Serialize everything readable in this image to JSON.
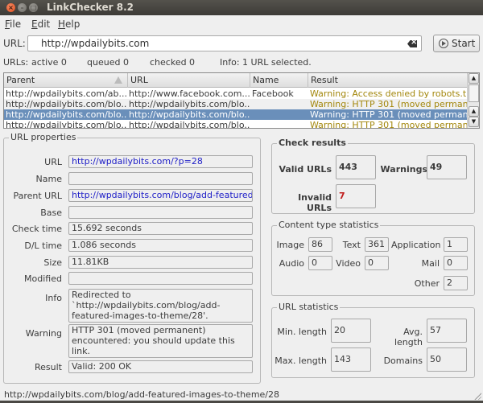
{
  "window": {
    "title": "LinkChecker 8.2"
  },
  "menu": {
    "items": [
      {
        "label": "File"
      },
      {
        "label": "Edit"
      },
      {
        "label": "Help"
      }
    ]
  },
  "url_bar": {
    "label": "URL:",
    "value": "http://wpdailybits.com",
    "start_label": "Start"
  },
  "status": {
    "urls_label": "URLs:",
    "active": "active 0",
    "queued": "queued 0",
    "checked": "checked 0",
    "info": "Info:  1 URL selected."
  },
  "table": {
    "headers": [
      "Parent",
      "URL",
      "Name",
      "Result"
    ],
    "rows": [
      {
        "parent": "http://wpdailybits.com/ab...",
        "url": "http://www.facebook.com...",
        "name": "Facebook",
        "result": "Warning: Access denied by robots.t..."
      },
      {
        "parent": "http://wpdailybits.com/blo...",
        "url": "http://wpdailybits.com/blo...",
        "name": "",
        "result": "Warning: HTTP 301 (moved perman..."
      },
      {
        "parent": "http://wpdailybits.com/blo...",
        "url": "http://wpdailybits.com/blo...",
        "name": "",
        "result": "Warning: HTTP 301 (moved perman..."
      },
      {
        "parent": "http://wpdailybits.com/blo...",
        "url": "http://wpdailybits.com/blo...",
        "name": "",
        "result": "Warning: HTTP 301 (moved perman..."
      }
    ],
    "selected_row": 2
  },
  "url_properties": {
    "title": "URL properties",
    "fields": [
      {
        "label": "URL",
        "value": "http://wpdailybits.com/?p=28"
      },
      {
        "label": "Name",
        "value": ""
      },
      {
        "label": "Parent URL",
        "value": "http://wpdailybits.com/blog/add-featured-ir"
      },
      {
        "label": "Base",
        "value": ""
      },
      {
        "label": "Check time",
        "value": "15.692 seconds"
      },
      {
        "label": "D/L time",
        "value": "1.086 seconds"
      },
      {
        "label": "Size",
        "value": "11.81KB"
      },
      {
        "label": "Modified",
        "value": ""
      },
      {
        "label": "Info",
        "value": "Redirected to `http://wpdailybits.com/blog/add-featured-images-to-theme/28'."
      },
      {
        "label": "Warning",
        "value": "HTTP 301 (moved permanent) encountered: you should update this link."
      },
      {
        "label": "Result",
        "value": "Valid: 200 OK"
      }
    ]
  },
  "check_results": {
    "title": "Check results",
    "valid_label": "Valid URLs",
    "valid": "443",
    "warnings_label": "Warnings",
    "warnings": "49",
    "invalid_label": "Invalid URLs",
    "invalid": "7",
    "invalid_color": "#c01c1c"
  },
  "content_types": {
    "title": "Content type statistics",
    "image_label": "Image",
    "image": "86",
    "text_label": "Text",
    "text": "361",
    "application_label": "Application",
    "application": "1",
    "audio_label": "Audio",
    "audio": "0",
    "video_label": "Video",
    "video": "0",
    "mail_label": "Mail",
    "mail": "0",
    "other_label": "Other",
    "other": "2"
  },
  "url_statistics": {
    "title": "URL statistics",
    "min_label": "Min. length",
    "min": "20",
    "avg_label": "Avg. length",
    "avg": "57",
    "max_label": "Max. length",
    "max": "143",
    "domains_label": "Domains",
    "domains": "50"
  },
  "statusbar": {
    "text": "http://wpdailybits.com/blog/add-featured-images-to-theme/28"
  },
  "colors": {
    "selection": "#6a8fba",
    "warning_text": "#a3870c",
    "link_text": "#2121c8"
  }
}
